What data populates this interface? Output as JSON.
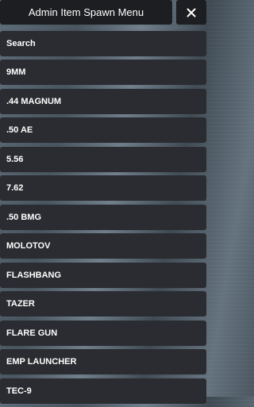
{
  "header": {
    "title": "Admin Item Spawn Menu",
    "close_icon": "close-x-icon"
  },
  "search": {
    "placeholder": "Search"
  },
  "items": [
    {
      "label": "9MM"
    },
    {
      "label": ".44 MAGNUM"
    },
    {
      "label": ".50 AE"
    },
    {
      "label": "5.56"
    },
    {
      "label": "7.62"
    },
    {
      "label": ".50 BMG"
    },
    {
      "label": "MOLOTOV"
    },
    {
      "label": "FLASHBANG"
    },
    {
      "label": "TAZER"
    },
    {
      "label": "FLARE GUN"
    },
    {
      "label": "EMP LAUNCHER"
    },
    {
      "label": "TEC-9"
    }
  ],
  "colors": {
    "panel": "#1d1e21",
    "item": "#2b2c31",
    "text": "#ffffff"
  }
}
